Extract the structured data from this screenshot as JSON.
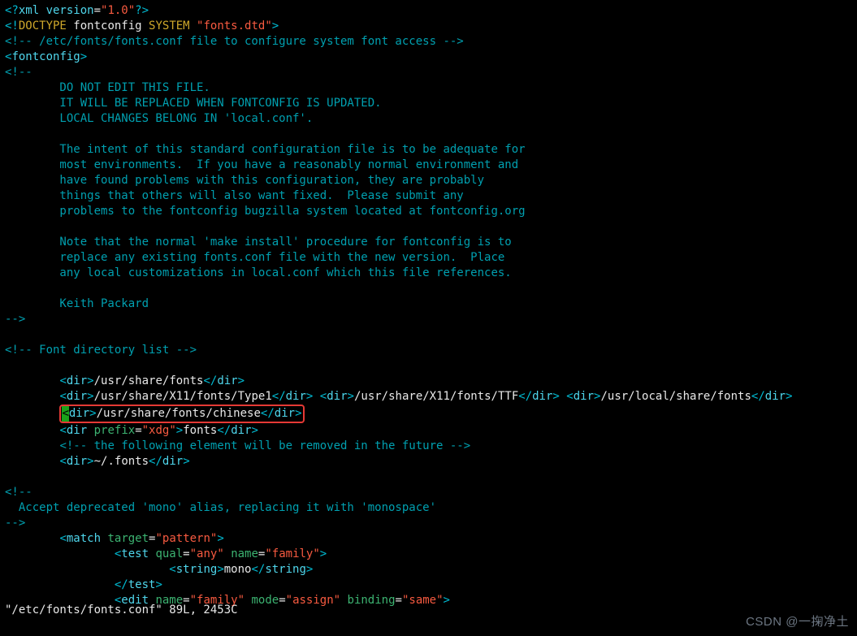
{
  "xml": {
    "tag1_open": "<?",
    "decl": "xml version",
    "eq": "=",
    "ver": "\"1.0\"",
    "tag1_close": "?>"
  },
  "doctype": {
    "open": "<!",
    "kw": "DOCTYPE",
    "name": " fontconfig ",
    "sys": "SYSTEM",
    "dtd": " \"fonts.dtd\"",
    "close": ">"
  },
  "comments": {
    "c1": "<!-- /etc/fonts/fonts.conf file to configure system font access -->",
    "block_open": "<!--",
    "b1": "        DO NOT EDIT THIS FILE.",
    "b2": "        IT WILL BE REPLACED WHEN FONTCONFIG IS UPDATED.",
    "b3": "        LOCAL CHANGES BELONG IN 'local.conf'.",
    "b4": "",
    "b5": "        The intent of this standard configuration file is to be adequate for",
    "b6": "        most environments.  If you have a reasonably normal environment and",
    "b7": "        have found problems with this configuration, they are probably",
    "b8": "        things that others will also want fixed.  Please submit any",
    "b9": "        problems to the fontconfig bugzilla system located at fontconfig.org",
    "b10": "",
    "b11": "        Note that the normal 'make install' procedure for fontconfig is to",
    "b12": "        replace any existing fonts.conf file with the new version.  Place",
    "b13": "        any local customizations in local.conf which this file references.",
    "b14": "",
    "b15": "        Keith Packard",
    "block_close": "-->",
    "fontdir": "<!-- Font directory list -->",
    "removed": "<!-- the following element will be removed in the future -->",
    "mono_open": "<!--",
    "mono_line": "  Accept deprecated 'mono' alias, replacing it with 'monospace'",
    "mono_close": "-->"
  },
  "fontconfig_open": "fontconfig",
  "dirs": {
    "d1": "/usr/share/fonts",
    "d2a": "/usr/share/X11/fonts/Type1",
    "d2b": "/usr/share/X11/fonts/TTF",
    "d2c": "/usr/local/share/fonts",
    "d3_cursor": "<",
    "d3_tag": "dir",
    "d3_path": "/usr/share/fonts/chinese",
    "d4_attr": "prefix",
    "d4_val": "\"xdg\"",
    "d4_text": "fonts",
    "d5": "~/.fonts"
  },
  "match": {
    "tag": "match",
    "target": "target",
    "target_val": "\"pattern\"",
    "test": "test",
    "qual": "qual",
    "qual_val": "\"any\"",
    "name_attr": "name",
    "name_val": "\"family\"",
    "string_tag": "string",
    "string_val": "mono",
    "test_close": "test",
    "edit": "edit",
    "edit_name_val": "\"family\"",
    "mode": "mode",
    "mode_val": "\"assign\"",
    "binding": "binding",
    "binding_val": "\"same\""
  },
  "status": "\"/etc/fonts/fonts.conf\" 89L, 2453C",
  "watermark": "CSDN @一掬净土"
}
